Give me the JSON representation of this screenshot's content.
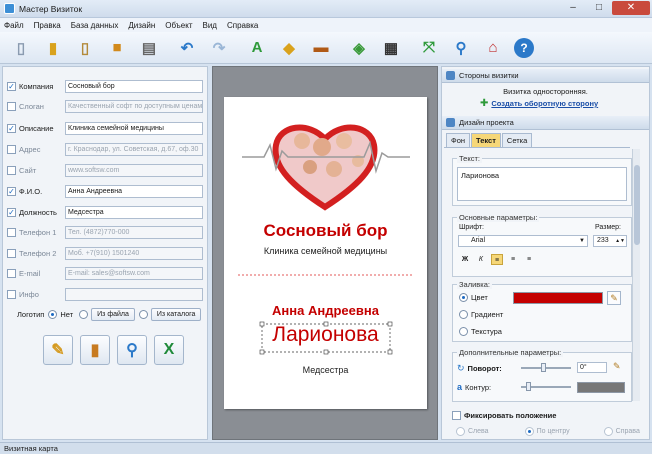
{
  "window": {
    "title": "Мастер Визиток"
  },
  "menu": [
    "Файл",
    "Правка",
    "База данных",
    "Дизайн",
    "Объект",
    "Вид",
    "Справка"
  ],
  "fields": [
    {
      "label": "Компания",
      "value": "Сосновый бор",
      "checked": true
    },
    {
      "label": "Слоган",
      "value": "Качественный софт по доступным ценам",
      "checked": false
    },
    {
      "label": "Описание",
      "value": "Клиника семейной медицины",
      "checked": true
    },
    {
      "label": "Адрес",
      "value": "г. Краснодар, ул. Советская, д.67, оф.30",
      "checked": false
    },
    {
      "label": "Сайт",
      "value": "www.softsw.com",
      "checked": false
    },
    {
      "label": "Ф.И.О.",
      "value": "Анна Андреевна",
      "checked": true
    },
    {
      "label": "Должность",
      "value": "Медсестра",
      "checked": true
    },
    {
      "label": "Телефон 1",
      "value": "Тел. (4872)770-000",
      "checked": false
    },
    {
      "label": "Телефон 2",
      "value": "Моб. +7(910) 1501240",
      "checked": false
    },
    {
      "label": "E-mail",
      "value": "E-mail: sales@softsw.com",
      "checked": false
    },
    {
      "label": "Инфо",
      "value": "",
      "checked": false
    }
  ],
  "logo": {
    "label": "Логотип",
    "none": "Нет",
    "from_file": "Из файла",
    "from_catalog": "Из каталога"
  },
  "card": {
    "company": "Сосновый бор",
    "description": "Клиника семейной медицины",
    "first_name": "Анна Андреевна",
    "last_name": "Ларионова",
    "position": "Медсестра"
  },
  "sides": {
    "header": "Стороны визитки",
    "info": "Визитка односторонняя.",
    "link": "Создать оборотную сторону"
  },
  "design": {
    "header": "Дизайн проекта",
    "tabs": [
      "Фон",
      "Текст",
      "Сетка"
    ],
    "active_tab": "Текст",
    "text_label": "Текст:",
    "text_value": "Ларионова",
    "basic_title": "Основные параметры:",
    "font_label": "Шрифт:",
    "font_value": "Arial",
    "size_label": "Размер:",
    "size_value": "233",
    "fill_title": "Заливка:",
    "fill_color": "Цвет",
    "fill_gradient": "Градиент",
    "fill_texture": "Текстура",
    "fill_hex": "#c40000",
    "extra_title": "Дополнительные параметры:",
    "rotation_label": "Поворот:",
    "rotation_value": "0°",
    "outline_label": "Контур:",
    "fix_label": "Фиксировать положение",
    "align_left": "Слева",
    "align_center": "По центру",
    "align_right": "Справа"
  },
  "status": "Визитная карта",
  "colors": {
    "brand_red": "#c40000",
    "link_blue": "#1b4fa8"
  }
}
